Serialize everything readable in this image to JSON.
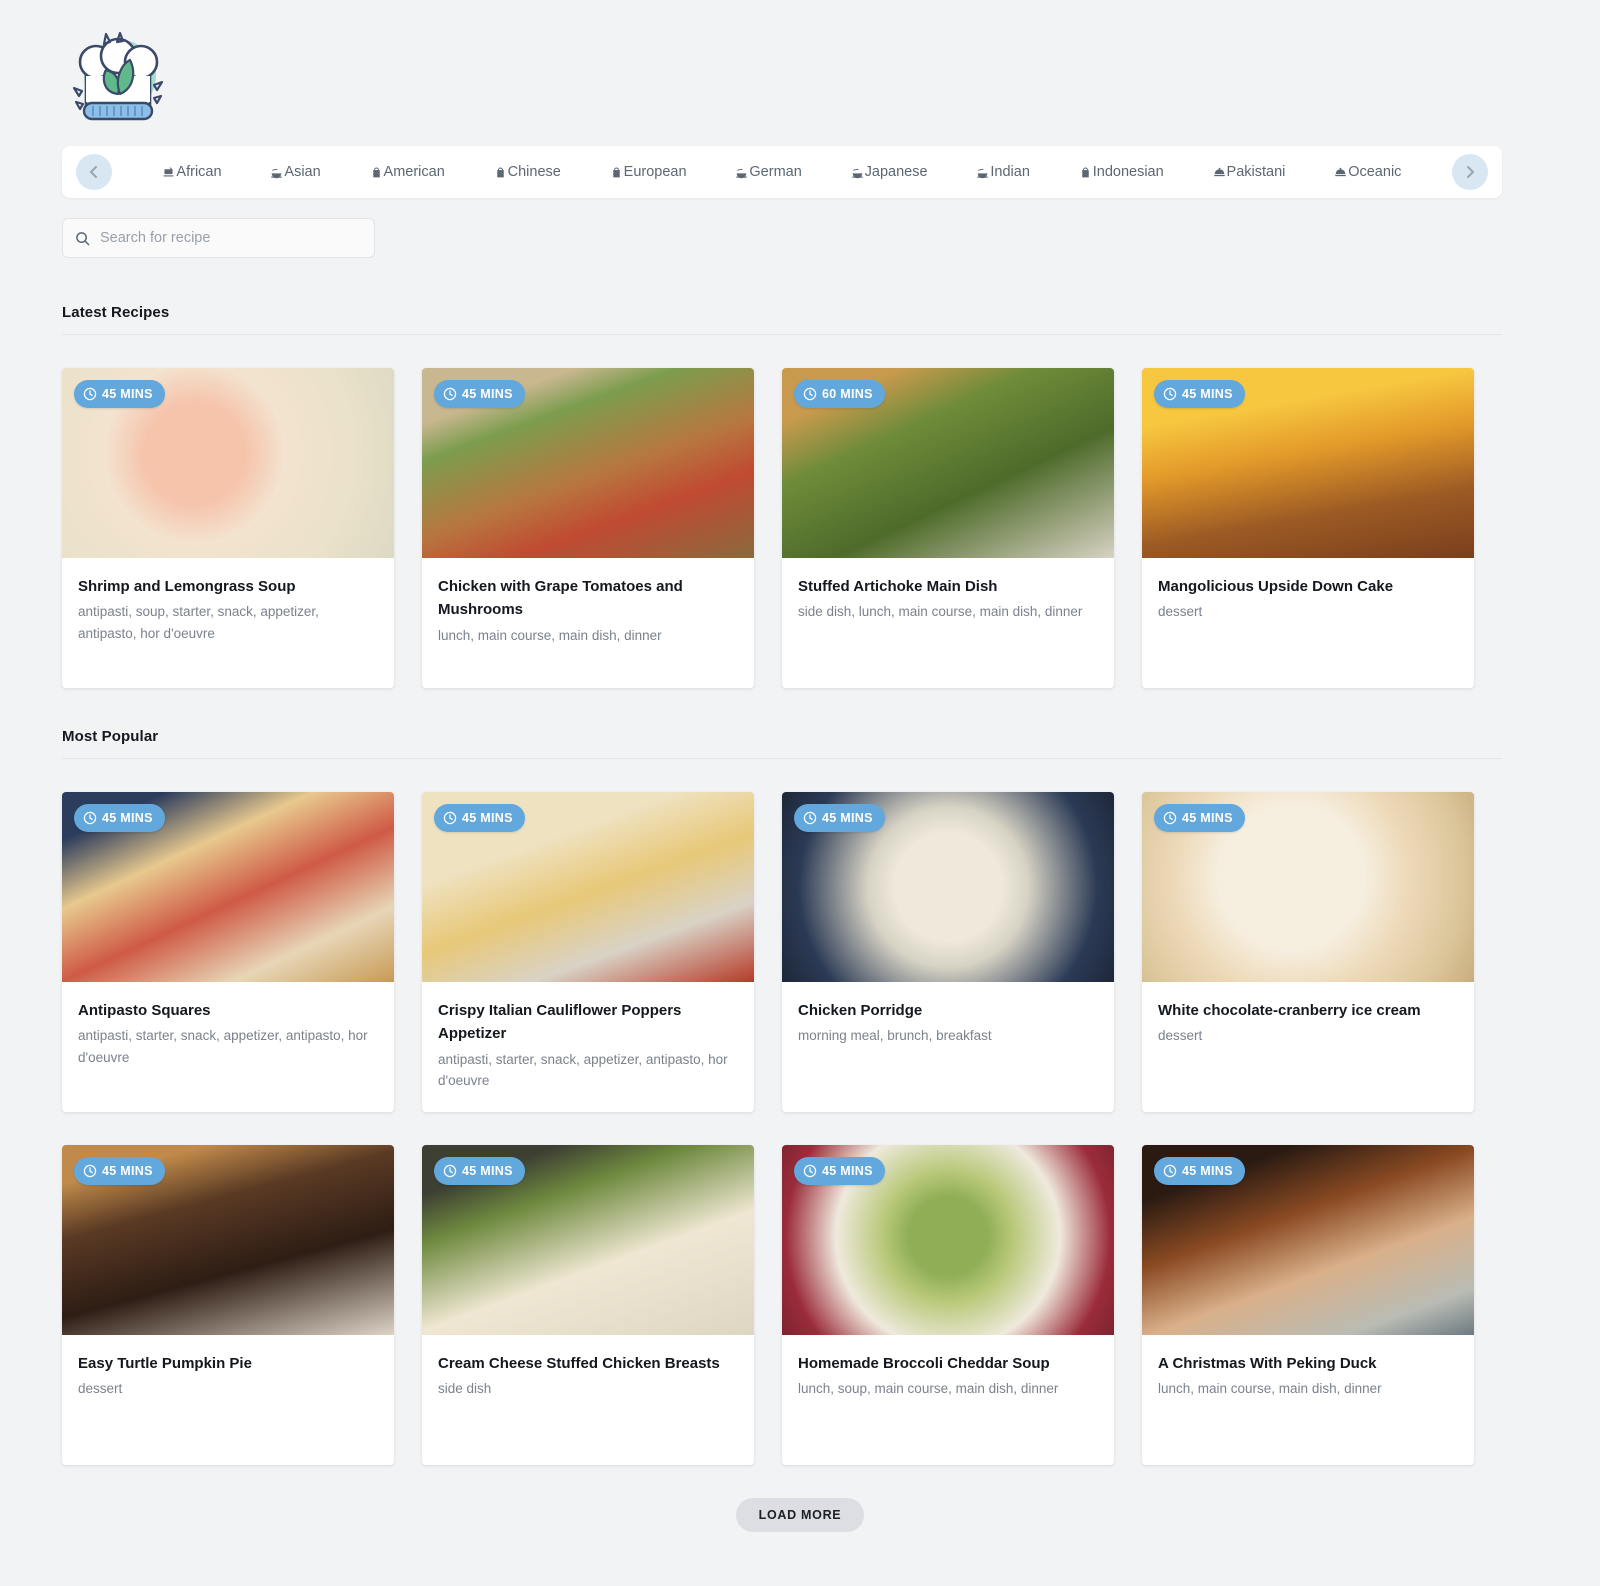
{
  "brand": {
    "logo_icon": "chef-hat-leaf-logo"
  },
  "cuisine_nav": {
    "prev_icon": "chevron-left-icon",
    "next_icon": "chevron-right-icon",
    "items": [
      {
        "label": "African",
        "icon": "mortar-pestle-icon"
      },
      {
        "label": "Asian",
        "icon": "noodle-bowl-icon"
      },
      {
        "label": "American",
        "icon": "takeout-bag-icon"
      },
      {
        "label": "Chinese",
        "icon": "takeout-bag-icon"
      },
      {
        "label": "European",
        "icon": "takeout-bag-icon"
      },
      {
        "label": "German",
        "icon": "sandwich-icon"
      },
      {
        "label": "Japanese",
        "icon": "noodle-bowl-icon"
      },
      {
        "label": "Indian",
        "icon": "noodle-bowl-icon"
      },
      {
        "label": "Indonesian",
        "icon": "takeout-bag-icon"
      },
      {
        "label": "Pakistani",
        "icon": "cloche-icon"
      },
      {
        "label": "Oceanic",
        "icon": "cloche-icon"
      }
    ]
  },
  "search": {
    "placeholder": "Search for recipe",
    "value": "",
    "icon": "search-icon"
  },
  "sections": [
    {
      "title": "Latest Recipes"
    },
    {
      "title": "Most Popular"
    }
  ],
  "latest_recipes": [
    {
      "title": "Shrimp and Lemongrass Soup",
      "tags": "antipasti, soup, starter, snack, appetizer, antipasto, hor d'oeuvre",
      "time": "45 MINS",
      "image_alt": "shrimp-and-lemongrass-soup-photo"
    },
    {
      "title": "Chicken with Grape Tomatoes and Mushrooms",
      "tags": "lunch, main course, main dish, dinner",
      "time": "45 MINS",
      "image_alt": "chicken-with-grape-tomatoes-photo"
    },
    {
      "title": "Stuffed Artichoke Main Dish",
      "tags": "side dish, lunch, main course, main dish, dinner",
      "time": "60 MINS",
      "image_alt": "stuffed-artichoke-photo"
    },
    {
      "title": "Mangolicious Upside Down Cake",
      "tags": "dessert",
      "time": "45 MINS",
      "image_alt": "mango-upside-down-cake-photo"
    }
  ],
  "most_popular": [
    {
      "title": "Antipasto Squares",
      "tags": "antipasti, starter, snack, appetizer, antipasto, hor d'oeuvre",
      "time": "45 MINS",
      "image_alt": "antipasto-squares-photo"
    },
    {
      "title": "Crispy Italian Cauliflower Poppers Appetizer",
      "tags": "antipasti, starter, snack, appetizer, antipasto, hor d'oeuvre",
      "time": "45 MINS",
      "image_alt": "cauliflower-poppers-photo"
    },
    {
      "title": "Chicken Porridge",
      "tags": "morning meal, brunch, breakfast",
      "time": "45 MINS",
      "image_alt": "chicken-porridge-photo"
    },
    {
      "title": "White chocolate-cranberry ice cream",
      "tags": "dessert",
      "time": "45 MINS",
      "image_alt": "white-chocolate-cranberry-ice-cream-photo"
    },
    {
      "title": "Easy Turtle Pumpkin Pie",
      "tags": "dessert",
      "time": "45 MINS",
      "image_alt": "turtle-pumpkin-pie-photo"
    },
    {
      "title": "Cream Cheese Stuffed Chicken Breasts",
      "tags": "side dish",
      "time": "45 MINS",
      "image_alt": "cream-cheese-stuffed-chicken-photo"
    },
    {
      "title": "Homemade Broccoli Cheddar Soup",
      "tags": "lunch, soup, main course, main dish, dinner",
      "time": "45 MINS",
      "image_alt": "broccoli-cheddar-soup-photo"
    },
    {
      "title": "A Christmas With Peking Duck",
      "tags": "lunch, main course, main dish, dinner",
      "time": "45 MINS",
      "image_alt": "peking-duck-photo"
    }
  ],
  "load_more": {
    "label": "LOAD MORE"
  },
  "colors": {
    "page_bg": "#f2f3f5",
    "badge_blue": "#63a8dc",
    "arrow_bg": "#d9e7f3",
    "card_bg": "#ffffff",
    "title_text": "#14181f",
    "tag_text": "#7b828c",
    "load_more_bg": "#dcdee3"
  }
}
